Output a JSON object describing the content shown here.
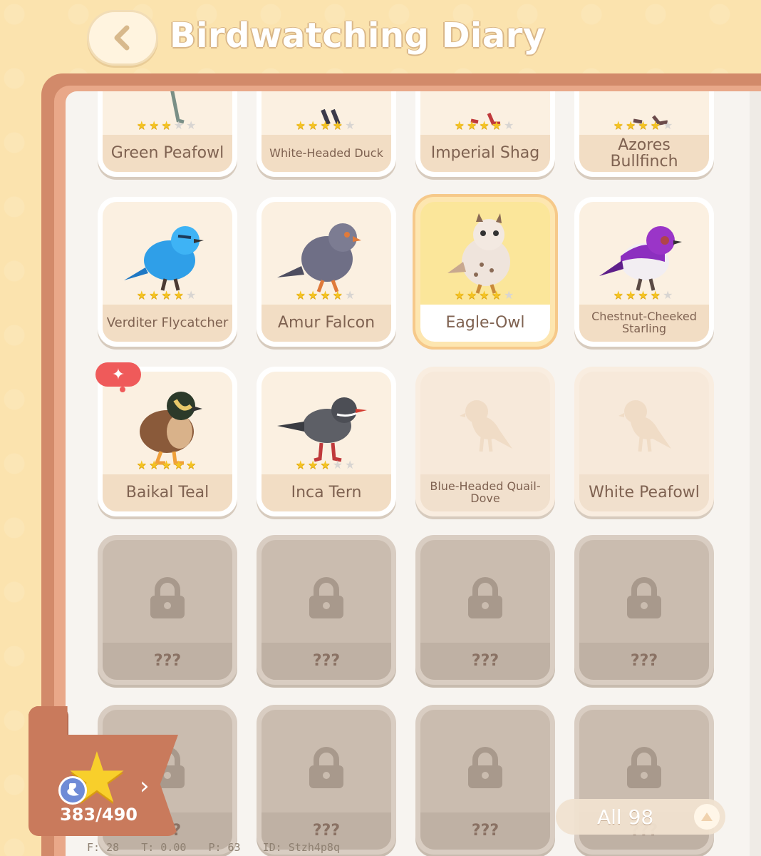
{
  "header": {
    "title": "Birdwatching Diary",
    "back_icon": "chevron-left-icon"
  },
  "birds": {
    "row1": [
      {
        "name": "Green Peafowl",
        "stars": 3
      },
      {
        "name": "White-Headed Duck",
        "stars": 4
      },
      {
        "name": "Imperial Shag",
        "stars": 4
      },
      {
        "name": "Azores Bullfinch",
        "stars": 4
      }
    ],
    "row2": [
      {
        "name": "Verditer Flycatcher",
        "stars": 4,
        "color": "#2f9fe8"
      },
      {
        "name": "Amur Falcon",
        "stars": 4,
        "color": "#6f6f86"
      },
      {
        "name": "Eagle-Owl",
        "stars": 4,
        "color": "#efe4dc",
        "selected": true
      },
      {
        "name": "Chestnut-Cheeked Starling",
        "stars": 4,
        "color": "#8c2fbf"
      }
    ],
    "row3": [
      {
        "name": "Baikal Teal",
        "stars": 5,
        "color": "#8a5a3a",
        "new": true
      },
      {
        "name": "Inca Tern",
        "stars": 3,
        "color": "#5d5f66"
      },
      {
        "name": "Blue-Headed Quail-Dove",
        "undiscovered": true
      },
      {
        "name": "White Peafowl",
        "undiscovered": true
      }
    ],
    "locked_label": "???"
  },
  "progress": {
    "count": "383/490",
    "icon": "star-icon"
  },
  "filter": {
    "label": "All 98",
    "toggle_icon": "triangle-up-icon"
  },
  "debug": {
    "f": "F: 28",
    "t": "T: 0.00",
    "p": "P: 63",
    "id": "ID: Stzh4p8q"
  },
  "colors": {
    "background": "#fbe3ae",
    "book": "#d28a6a",
    "star": "#f4c323",
    "accent_badge": "#ef5a5a"
  }
}
